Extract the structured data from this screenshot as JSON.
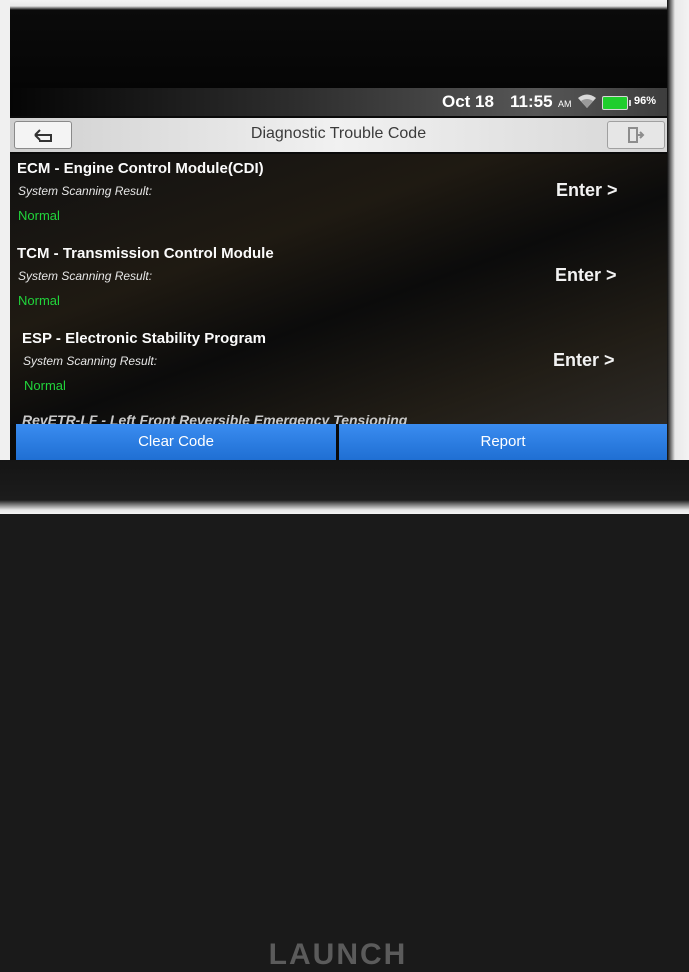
{
  "status": {
    "date": "Oct 18",
    "time": "11:55",
    "ampm": "AM",
    "battery": "96%",
    "battery_color": "#1fce2d"
  },
  "header": {
    "title": "Diagnostic Trouble Code",
    "back_icon": "back-arrow-icon",
    "exit_icon": "exit-icon"
  },
  "modules": [
    {
      "name": "ECM - Engine Control Module(CDI)",
      "sub": "System Scanning Result:",
      "status": "Normal",
      "action": "Enter >"
    },
    {
      "name": "TCM - Transmission Control Module",
      "sub": "System Scanning Result:",
      "status": "Normal",
      "action": "Enter >"
    },
    {
      "name": "ESP - Electronic Stability Program",
      "sub": "System Scanning Result:",
      "status": "Normal",
      "action": "Enter >"
    }
  ],
  "partial_row": "RevETR-LF - Left Front Reversible Emergency Tensioning",
  "footer": {
    "clear_label": "Clear Code",
    "report_label": "Report"
  },
  "brand": "LAUNCH",
  "colors": {
    "normal": "#21d43b",
    "button": "#2a7fe6"
  }
}
